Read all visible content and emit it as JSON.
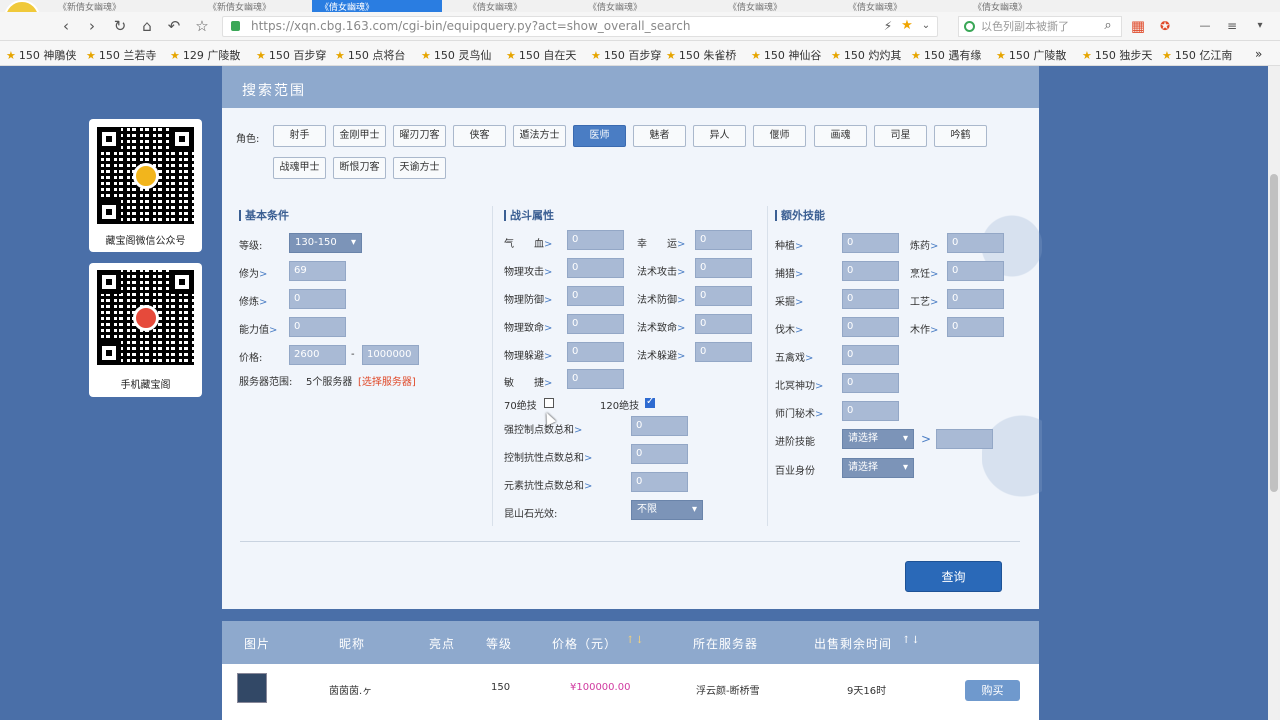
{
  "browser": {
    "tabs": [
      "《新倩女幽魂》",
      "《新倩女幽魂》",
      "《倩女幽魂》",
      "《倩女幽魂》",
      "《倩女幽魂》",
      "《倩女幽魂》",
      "《倩女幽魂》",
      "《倩女幽魂》"
    ],
    "url": "https://xqn.cbg.163.com/cgi-bin/equipquery.py?act=show_overall_search",
    "search_placeholder": "以色列副本被撕了",
    "bookmarks": [
      "150 神鵰侠",
      "150 兰若寺",
      "129 广陵散",
      "150 百步穿",
      "150 点将台",
      "150 灵鸟仙",
      "150 自在天",
      "150 百步穿",
      "150 朱雀桥",
      "150 神仙谷",
      "150 灼灼其",
      "150 遇有缘",
      "150 广陵散",
      "150 独步天",
      "150 亿江南"
    ],
    "more": "»"
  },
  "qr": {
    "wechat_caption": "藏宝阁微信公众号",
    "mobile_caption": "手机藏宝阁"
  },
  "search": {
    "title": "搜索范围",
    "role_label": "角色:",
    "roles": [
      "射手",
      "金刚甲士",
      "曜刃刀客",
      "侠客",
      "遁法方士",
      "医师",
      "魅者",
      "异人",
      "偃师",
      "画魂",
      "司星",
      "吟鹤",
      "战魂甲士",
      "断恨刀客",
      "天谕方士"
    ],
    "selected_role": "医师",
    "basic": {
      "title": "基本条件",
      "level_label": "等级:",
      "level_value": "130-150",
      "xiuwei_label": "修为",
      "xiuwei_value": "69",
      "xiulian_label": "修炼",
      "xiulian_value": "0",
      "ability_label": "能力值",
      "ability_value": "0",
      "price_label": "价格:",
      "price_min": "2600",
      "price_sep": "-",
      "price_max": "1000000",
      "server_label": "服务器范围:",
      "server_count": "5个服务器",
      "server_link": "[选择服务器]"
    },
    "combat": {
      "title": "战斗属性",
      "left": [
        {
          "label": "气　　血",
          "value": "0"
        },
        {
          "label": "物理攻击",
          "value": "0"
        },
        {
          "label": "物理防御",
          "value": "0"
        },
        {
          "label": "物理致命",
          "value": "0"
        },
        {
          "label": "物理躲避",
          "value": "0"
        },
        {
          "label": "敏　　捷",
          "value": "0"
        }
      ],
      "right": [
        {
          "label": "幸　　运",
          "value": "0"
        },
        {
          "label": "法术攻击",
          "value": "0"
        },
        {
          "label": "法术防御",
          "value": "0"
        },
        {
          "label": "法术致命",
          "value": "0"
        },
        {
          "label": "法术躲避",
          "value": "0"
        }
      ],
      "skill70_label": "70绝技",
      "skill120_label": "120绝技",
      "skill70_checked": false,
      "skill120_checked": true,
      "extra": [
        {
          "label": "强控制点数总和",
          "value": "0"
        },
        {
          "label": "控制抗性点数总和",
          "value": "0"
        },
        {
          "label": "元素抗性点数总和",
          "value": "0"
        }
      ],
      "kunshan_label": "昆山石光效:",
      "kunshan_value": "不限"
    },
    "extra_skills": {
      "title": "额外技能",
      "left": [
        {
          "label": "种植",
          "value": "0"
        },
        {
          "label": "捕猎",
          "value": "0"
        },
        {
          "label": "采掘",
          "value": "0"
        },
        {
          "label": "伐木",
          "value": "0"
        },
        {
          "label": "五禽戏",
          "value": "0"
        },
        {
          "label": "北冥神功",
          "value": "0"
        },
        {
          "label": "师门秘术",
          "value": "0"
        }
      ],
      "right": [
        {
          "label": "炼药",
          "value": "0"
        },
        {
          "label": "烹饪",
          "value": "0"
        },
        {
          "label": "工艺",
          "value": "0"
        },
        {
          "label": "木作",
          "value": "0"
        }
      ],
      "advanced_label": "进阶技能",
      "advanced_value": "请选择",
      "identity_label": "百业身份",
      "identity_value": "请选择"
    },
    "query_button": "查询"
  },
  "results": {
    "headers": [
      "图片",
      "昵称",
      "亮点",
      "等级",
      "价格（元）",
      "所在服务器",
      "出售剩余时间"
    ],
    "sort_arrows": "↑↓",
    "rows": [
      {
        "name": "茵茵茵.ヶ",
        "level": "150",
        "price": "¥100000.00",
        "server": "浮云颜-断桥雪",
        "time": "9天16时",
        "buy": "购买"
      }
    ]
  }
}
